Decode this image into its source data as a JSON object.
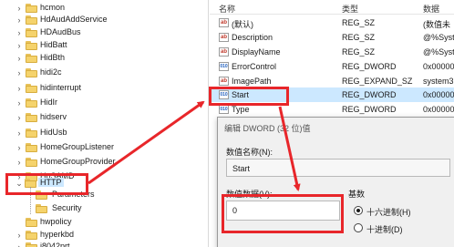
{
  "tree": {
    "items": [
      {
        "label": "hcmon",
        "expanded": false
      },
      {
        "label": "HdAudAddService",
        "expanded": false
      },
      {
        "label": "HDAudBus",
        "expanded": false
      },
      {
        "label": "HidBatt",
        "expanded": false
      },
      {
        "label": "HidBth",
        "expanded": false
      },
      {
        "label": "hidi2c",
        "expanded": false
      },
      {
        "label": "hidinterrupt",
        "expanded": false
      },
      {
        "label": "HidIr",
        "expanded": false
      },
      {
        "label": "hidserv",
        "expanded": false
      },
      {
        "label": "HidUsb",
        "expanded": false
      },
      {
        "label": "HomeGroupListener",
        "expanded": false
      },
      {
        "label": "HomeGroupProvider",
        "expanded": false
      },
      {
        "label": "HpSAMD",
        "expanded": false
      },
      {
        "label": "HTTP",
        "expanded": true
      },
      {
        "label": "Parameters",
        "child": true
      },
      {
        "label": "Security",
        "child": true
      },
      {
        "label": "hwpolicy",
        "expanded": false
      },
      {
        "label": "hyperkbd",
        "expanded": false
      },
      {
        "label": "i8042prt",
        "expanded": false
      }
    ]
  },
  "values": {
    "headers": {
      "name": "名称",
      "type": "类型",
      "data": "数据"
    },
    "rows": [
      {
        "icon": "ab",
        "name": "(默认)",
        "type": "REG_SZ",
        "data": "(数值未"
      },
      {
        "icon": "ab",
        "name": "Description",
        "type": "REG_SZ",
        "data": "@%Syst"
      },
      {
        "icon": "ab",
        "name": "DisplayName",
        "type": "REG_SZ",
        "data": "@%Syst"
      },
      {
        "icon": "bin",
        "name": "ErrorControl",
        "type": "REG_DWORD",
        "data": "0x00000"
      },
      {
        "icon": "ab",
        "name": "ImagePath",
        "type": "REG_EXPAND_SZ",
        "data": "system3"
      },
      {
        "icon": "bin",
        "name": "Start",
        "type": "REG_DWORD",
        "data": "0x00000"
      },
      {
        "icon": "bin",
        "name": "Type",
        "type": "REG_DWORD",
        "data": "0x00000"
      }
    ]
  },
  "dialog": {
    "title": "编辑 DWORD (32 位)值",
    "value_name_label": "数值名称(N):",
    "value_name": "Start",
    "value_data_label": "数值数据(V):",
    "value_data": "0",
    "base_label": "基数",
    "hex_label": "十六进制(H)",
    "dec_label": "十进制(D)",
    "selected_base": "hex"
  },
  "colors": {
    "highlight_red": "#e8262a",
    "selection_blue": "#cce8ff",
    "folder_yellow": "#f5d36c"
  }
}
